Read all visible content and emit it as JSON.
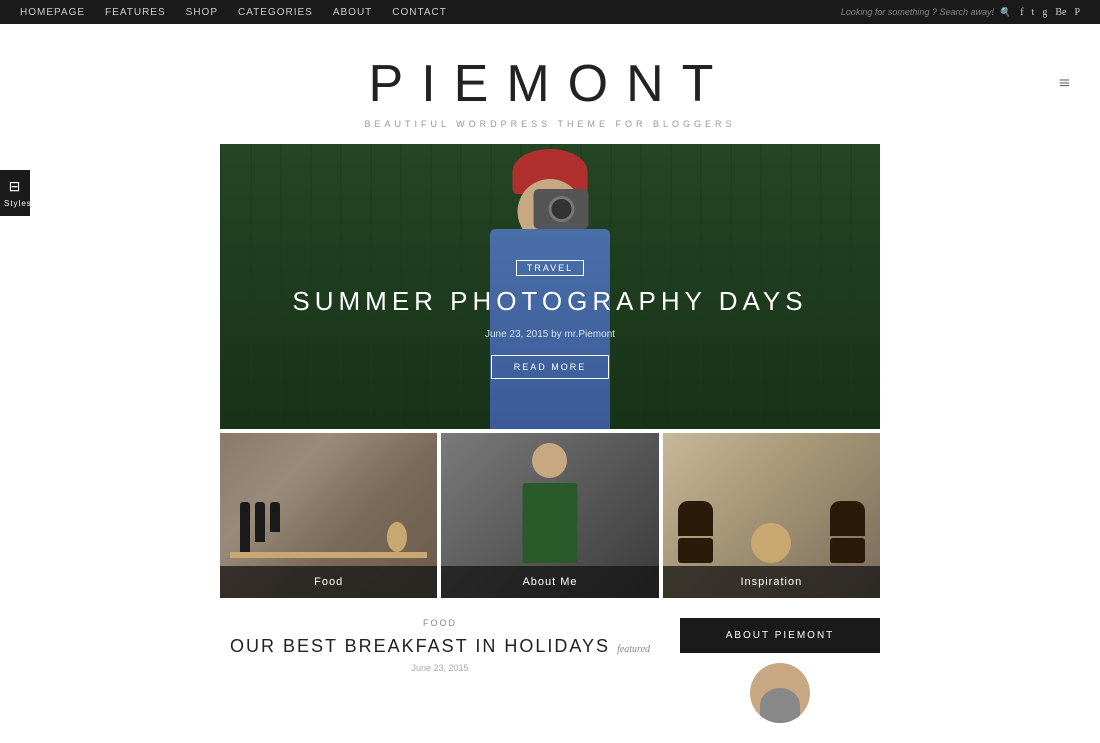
{
  "topbar": {
    "nav": [
      {
        "label": "HOMEPAGE",
        "id": "homepage",
        "active": false
      },
      {
        "label": "FEATURES",
        "id": "features",
        "active": false
      },
      {
        "label": "SHOP",
        "id": "shop",
        "active": false
      },
      {
        "label": "CATEGORIES",
        "id": "categories",
        "active": false
      },
      {
        "label": "ABOUT",
        "id": "about",
        "active": false
      },
      {
        "label": "CONTACT",
        "id": "contact",
        "active": false
      }
    ],
    "search_placeholder": "Looking for something ? Search away!",
    "social": [
      "f",
      "t",
      "g+",
      "Be",
      "P"
    ]
  },
  "header": {
    "logo": "PIEMONT",
    "tagline": "BEAUTIFUL  WORDPRESS THEME FOR BLOGGERS",
    "menu_icon": "≡"
  },
  "styles_button": {
    "icon": "⊟",
    "label": "Styles"
  },
  "hero": {
    "tag": "TRAVEL",
    "title": "SUMMER PHOTOGRAPHY DAYS",
    "meta": "June 23, 2015 by mr.Piemont",
    "read_more": "READ MORE"
  },
  "cards": [
    {
      "label": "Food",
      "id": "food"
    },
    {
      "label": "About me",
      "id": "about-me"
    },
    {
      "label": "Inspiration",
      "id": "inspiration"
    }
  ],
  "bottom": {
    "food_tag": "FOOD",
    "article_title": "OUR BEST BREAKFAST IN HOLIDAYS",
    "featured_label": "featured",
    "article_date": "June 23, 2015",
    "about_btn": "ABOUT PIEMONT"
  }
}
